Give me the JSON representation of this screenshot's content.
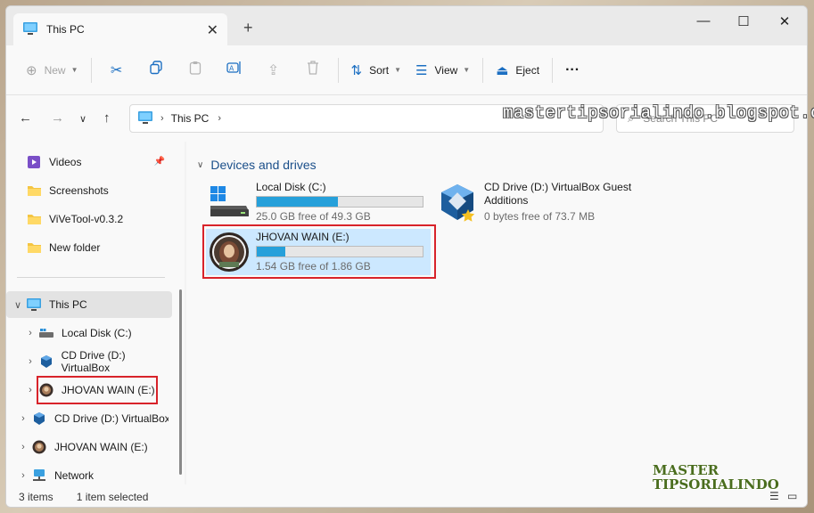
{
  "window": {
    "tab_title": "This PC",
    "tab_close": "✕",
    "new_tab": "+",
    "minimize": "—",
    "maximize": "☐",
    "close": "✕"
  },
  "toolbar": {
    "new_label": "New",
    "sort_label": "Sort",
    "view_label": "View",
    "eject_label": "Eject",
    "more_label": "···"
  },
  "address": {
    "path": "This PC",
    "search_placeholder": "Search This PC"
  },
  "sidebar": {
    "quick_access": [
      {
        "label": "Videos",
        "icon": "videos-folder-icon"
      },
      {
        "label": "Screenshots",
        "icon": "folder-icon"
      },
      {
        "label": "ViVeTool-v0.3.2",
        "icon": "folder-icon"
      },
      {
        "label": "New folder",
        "icon": "folder-icon"
      }
    ],
    "this_pc": "This PC",
    "this_pc_children": [
      {
        "label": "Local Disk (C:)",
        "icon": "drive-icon"
      },
      {
        "label": "CD Drive (D:) VirtualBox",
        "icon": "virtualbox-icon"
      },
      {
        "label": "JHOVAN WAIN (E:)",
        "icon": "avatar-drive-icon"
      }
    ],
    "roots": [
      {
        "label": "CD Drive (D:) VirtualBox G",
        "icon": "virtualbox-icon"
      },
      {
        "label": "JHOVAN WAIN (E:)",
        "icon": "avatar-drive-icon"
      },
      {
        "label": "Network",
        "icon": "network-icon"
      }
    ]
  },
  "content": {
    "group_title": "Devices and drives",
    "drives": [
      {
        "name": "Local Disk (C:)",
        "free": "25.0 GB free of 49.3 GB",
        "used_fraction": 0.49
      },
      {
        "name": "CD Drive (D:) VirtualBox Guest Additions",
        "free": "0 bytes free of 73.7 MB"
      },
      {
        "name": "JHOVAN WAIN (E:)",
        "free": "1.54 GB free of 1.86 GB",
        "used_fraction": 0.17
      }
    ]
  },
  "status": {
    "items": "3 items",
    "selected": "1 item selected"
  },
  "watermarks": {
    "url": "mastertipsorialindo.blogspot.com",
    "logo_line1": "MASTER",
    "logo_line2": "TIPSORIALINDO"
  },
  "colors": {
    "accent": "#26a0da",
    "selection": "#cce8ff",
    "highlight_box": "#d8232a"
  }
}
